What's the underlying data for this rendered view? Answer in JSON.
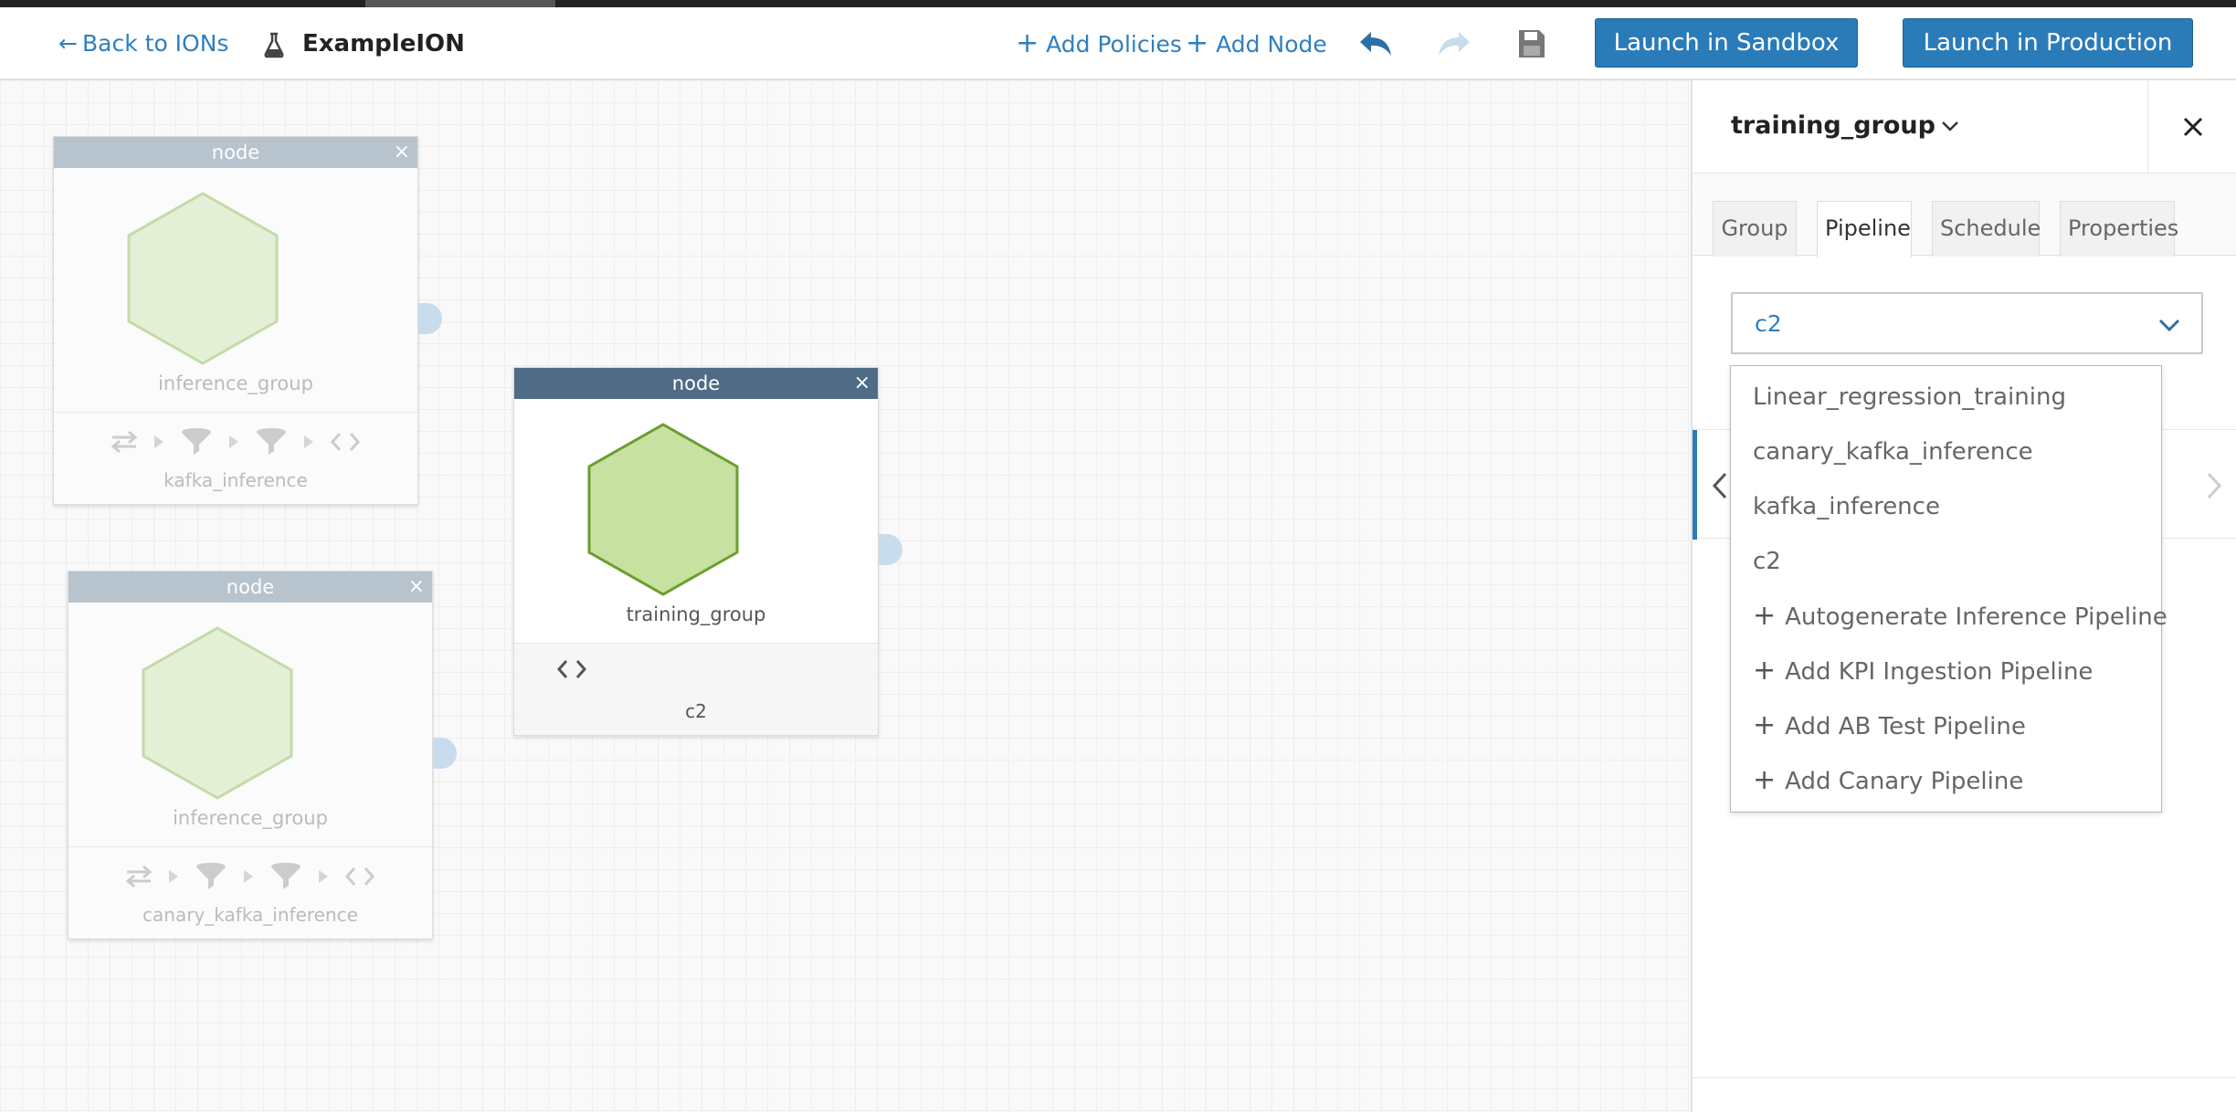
{
  "toolbar": {
    "back_label": "Back to IONs",
    "ion_name": "ExampleION",
    "add_policies": "Add Policies",
    "add_node": "Add Node",
    "launch_sandbox": "Launch in Sandbox",
    "launch_production": "Launch in Production",
    "icons": [
      "arrow-left-icon",
      "flask-icon",
      "plus-icon",
      "undo-icon",
      "redo-icon",
      "save-icon"
    ]
  },
  "nodes": [
    {
      "header": "node",
      "group": "inference_group",
      "pipeline": "kafka_inference",
      "state": "faded"
    },
    {
      "header": "node",
      "group": "training_group",
      "pipeline": "c2",
      "state": "active"
    },
    {
      "header": "node",
      "group": "inference_group",
      "pipeline": "canary_kafka_inference",
      "state": "faded"
    }
  ],
  "panel": {
    "title": "training_group",
    "tabs": [
      "Group",
      "Pipeline",
      "Schedule",
      "Properties"
    ],
    "active_tab": "Pipeline",
    "selected_pipeline": "c2"
  },
  "dropdown": {
    "options": [
      "Linear_regression_training",
      "canary_kafka_inference",
      "kafka_inference",
      "c2"
    ],
    "actions": [
      "Autogenerate Inference Pipeline",
      "Add KPI Ingestion Pipeline",
      "Add AB Test Pipeline",
      "Add Canary Pipeline"
    ]
  },
  "colors": {
    "accent": "#2b7bb9",
    "link": "#2f7fbf",
    "active_node_header": "#4f6b86",
    "inactive_node_header": "#b7c3cd",
    "hexagon_active_fill": "#c6e1a0",
    "hexagon_active_stroke": "#6b9e2e",
    "hexagon_faded_fill": "#e3f0d6",
    "hexagon_faded_stroke": "#c2dba8"
  }
}
